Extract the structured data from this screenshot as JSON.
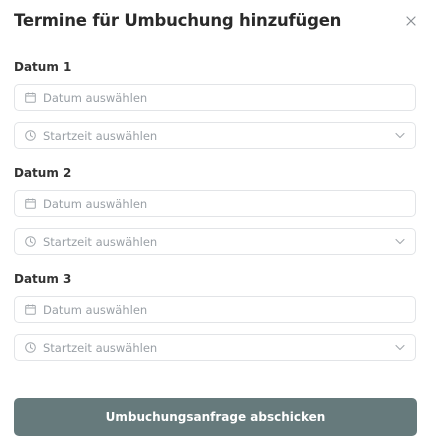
{
  "dialog": {
    "title": "Termine für Umbuchung hinzufügen",
    "close_icon": "close-icon"
  },
  "dates": [
    {
      "label": "Datum 1",
      "date_placeholder": "Datum auswählen",
      "time_placeholder": "Startzeit auswählen"
    },
    {
      "label": "Datum 2",
      "date_placeholder": "Datum auswählen",
      "time_placeholder": "Startzeit auswählen"
    },
    {
      "label": "Datum 3",
      "date_placeholder": "Datum auswählen",
      "time_placeholder": "Startzeit auswählen"
    }
  ],
  "icons": {
    "date": "calendar-icon",
    "time": "clock-icon",
    "dropdown": "chevron-down-icon"
  },
  "submit_label": "Umbuchungsanfrage abschicken",
  "colors": {
    "submit_bg": "#667a7c",
    "placeholder": "#9aa0a6",
    "border": "#e2e4e7"
  }
}
